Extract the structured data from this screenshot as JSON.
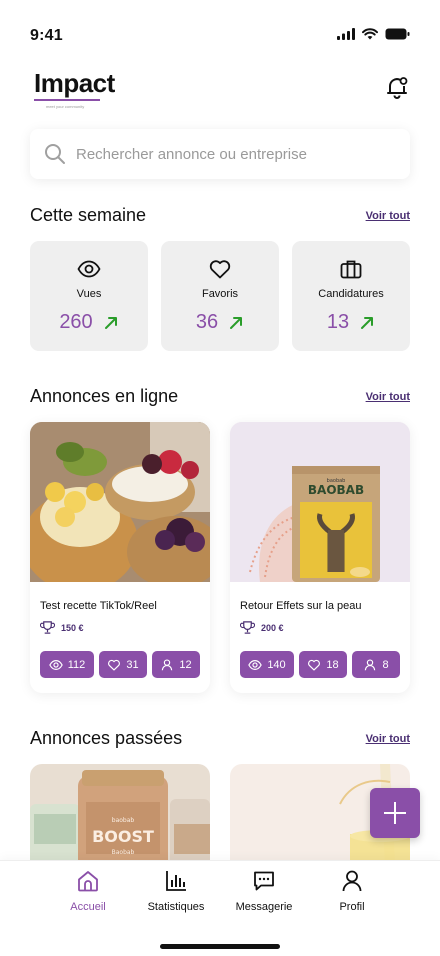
{
  "status_bar": {
    "time": "9:41"
  },
  "header": {
    "logo_text": "Impact",
    "logo_tagline": "meet your community"
  },
  "search": {
    "placeholder": "Rechercher annonce ou entreprise"
  },
  "colors": {
    "accent": "#8a4fa8",
    "dark_accent": "#4a2f72",
    "card_bg": "#efefef",
    "trend_up": "#2a9d2a"
  },
  "this_week": {
    "title": "Cette semaine",
    "see_all": "Voir tout",
    "stats": [
      {
        "icon": "eye-icon",
        "label": "Vues",
        "value": "260",
        "trend": "up"
      },
      {
        "icon": "heart-icon",
        "label": "Favoris",
        "value": "36",
        "trend": "up"
      },
      {
        "icon": "briefcase-icon",
        "label": "Candidatures",
        "value": "13",
        "trend": "up"
      }
    ]
  },
  "online_ads": {
    "title": "Annonces en ligne",
    "see_all": "Voir tout",
    "items": [
      {
        "title": "Test recette TikTok/Reel",
        "price": "150 €",
        "views": "112",
        "likes": "31",
        "applicants": "12"
      },
      {
        "title": "Retour Effets sur la peau",
        "price": "200 €",
        "views": "140",
        "likes": "18",
        "applicants": "8",
        "product_brand": "baobab",
        "product_name": "BAOBAB"
      }
    ]
  },
  "past_ads": {
    "title": "Annonces passées",
    "see_all": "Voir tout",
    "product_label": "BOOST",
    "product_sub": "Baobab",
    "product_brand": "baobab"
  },
  "tabbar": {
    "tabs": [
      {
        "label": "Accueil",
        "icon": "home-icon",
        "active": true
      },
      {
        "label": "Statistiques",
        "icon": "bar-chart-icon",
        "active": false
      },
      {
        "label": "Messagerie",
        "icon": "message-icon",
        "active": false
      },
      {
        "label": "Profil",
        "icon": "user-icon",
        "active": false
      }
    ]
  }
}
